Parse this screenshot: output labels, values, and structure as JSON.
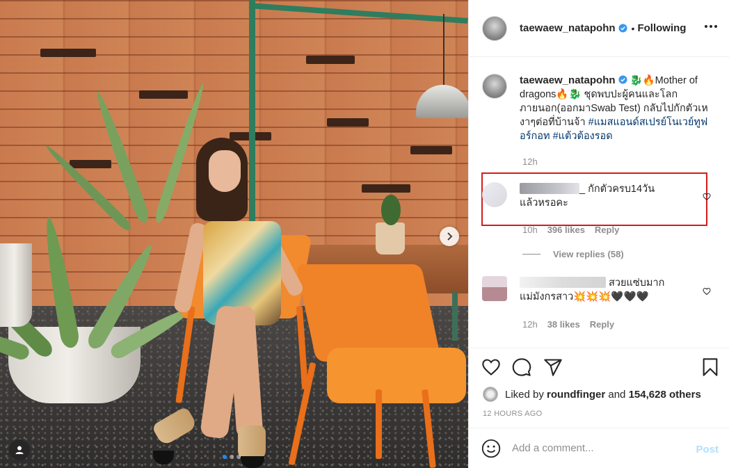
{
  "post": {
    "username": "taewaew_natapohn",
    "follow_separator": "•",
    "follow_label": "Following",
    "caption_text": "🐉🔥Mother of dragons🔥🐉 ชุดพบปะผู้คนและโลกภายนอก(ออกมาSwab Test) กลับไปกักตัวเหงาๆต่อที่บ้านจ้า",
    "hashtags": [
      "#แมสแอนด์สเปรย์โนเวย์ทูฟอร์กอท",
      "#แต้วต้องรอด"
    ],
    "caption_time": "12h"
  },
  "comments": [
    {
      "name_visible": "_",
      "text": "กักตัวครบ14วันแล้วหรอคะ",
      "time": "10h",
      "likes": "396 likes",
      "reply_label": "Reply",
      "highlighted": true
    },
    {
      "text": "สวยแซ่บมากแม่มังกรสาว💥💥💥🖤🖤🖤",
      "time": "12h",
      "likes": "38 likes",
      "reply_label": "Reply"
    }
  ],
  "view_replies": "View replies (58)",
  "likes": {
    "prefix": "Liked by",
    "user": "roundfinger",
    "joiner": "and",
    "others": "154,628 others"
  },
  "timeago": "12 HOURS AGO",
  "add_comment": {
    "placeholder": "Add a comment...",
    "post_label": "Post"
  },
  "carousel": {
    "dots": 3,
    "active_index": 0
  },
  "colors": {
    "verified": "#3897f0",
    "highlight_border": "#d51b1b",
    "hashtag": "#00376b",
    "post_disabled": "#b2dffc"
  },
  "icons": {
    "like": "heart-icon",
    "comment": "comment-icon",
    "share": "paper-plane-icon",
    "save": "bookmark-icon",
    "emoji": "smiley-icon",
    "more": "ellipsis-icon",
    "next": "chevron-right-icon",
    "tags": "user-tag-icon"
  }
}
